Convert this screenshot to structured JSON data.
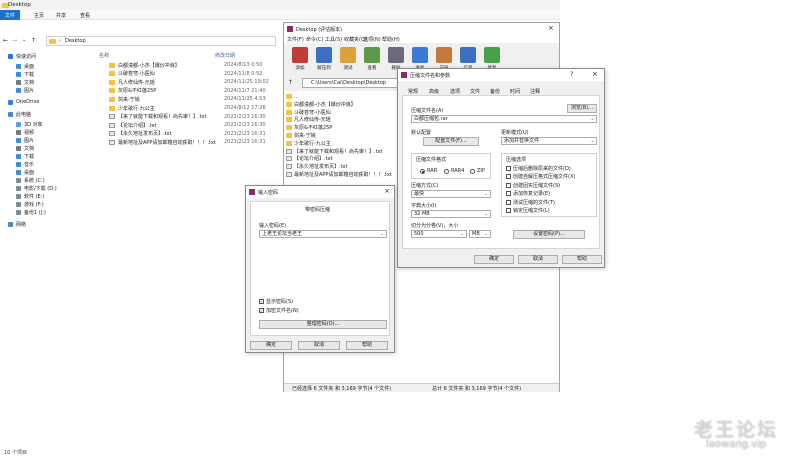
{
  "explorer": {
    "title": "Desktop",
    "ribbon_tabs": [
      "文件",
      "主页",
      "共享",
      "查看"
    ],
    "address": "Desktop",
    "columns": {
      "name": "名称",
      "date": "修改日期"
    },
    "nav": [
      {
        "label": "快速访问",
        "color": "#2b73d8"
      },
      {
        "label": "桌面",
        "color": "#3a8ee6"
      },
      {
        "label": "下载",
        "color": "#3a8ee6"
      },
      {
        "label": "文档",
        "color": "#6b7b8c"
      },
      {
        "label": "图片",
        "color": "#3a8ee6"
      },
      {
        "label": "OneDrive",
        "color": "#2f7fdf"
      },
      {
        "label": "此电脑",
        "color": "#4a88c7"
      },
      {
        "label": "3D 对象",
        "color": "#55a0e0"
      },
      {
        "label": "视频",
        "color": "#6b7b8c"
      },
      {
        "label": "图片",
        "color": "#3a8ee6"
      },
      {
        "label": "文档",
        "color": "#6b7b8c"
      },
      {
        "label": "下载",
        "color": "#3a8ee6"
      },
      {
        "label": "音乐",
        "color": "#3a8ee6"
      },
      {
        "label": "桌面",
        "color": "#3a8ee6"
      },
      {
        "label": "系统 (C:)",
        "color": "#7a8a9a"
      },
      {
        "label": "电影/下载 (D:)",
        "color": "#7a8a9a"
      },
      {
        "label": "软件 (E:)",
        "color": "#7a8a9a"
      },
      {
        "label": "游戏 (F:)",
        "color": "#7a8a9a"
      },
      {
        "label": "备份1 (J:)",
        "color": "#7a8a9a"
      },
      {
        "label": "网络",
        "color": "#4a88c7"
      }
    ],
    "files": [
      {
        "name": "白都濛都-小杰【爆炒冲浪】",
        "date": "2024/8/13 0:50",
        "type": "folder"
      },
      {
        "name": "斗破苍穹-小医仙",
        "date": "2024/11/8 0:52",
        "type": "folder"
      },
      {
        "name": "凡人修仙传-元瑶",
        "date": "2024/11/25 19:02",
        "type": "folder"
      },
      {
        "name": "灰原&不红莲25P",
        "date": "2024/11/7 21:40",
        "type": "folder"
      },
      {
        "name": "剑来-宁姚",
        "date": "2024/11/25 4:53",
        "type": "folder"
      },
      {
        "name": "少年歌行-九公主",
        "date": "2024/8/12 17:26",
        "type": "folder"
      },
      {
        "name": "【来了就能下载和观看！尚先审！】.txt",
        "date": "2023/2/23 16:30",
        "type": "txt"
      },
      {
        "name": "【论坛介绍】.txt",
        "date": "2023/2/23 16:30",
        "type": "txt"
      },
      {
        "name": "【永久地址发布页】.txt",
        "date": "2023/2/23 16:31",
        "type": "txt"
      },
      {
        "name": "最新地址及APP请加邮箱自动获取！！！.txt",
        "date": "2023/2/23 16:31",
        "type": "txt"
      }
    ],
    "status": "10 个项目"
  },
  "winrar": {
    "title": "Desktop (评估版本)",
    "menu": [
      "文件(F)",
      "命令(C)",
      "工具(S)",
      "收藏夹(O)",
      "选项(N)",
      "帮助(H)"
    ],
    "toolbar": [
      {
        "label": "添加",
        "color": "#c23a3a"
      },
      {
        "label": "解压到",
        "color": "#3a6fc2"
      },
      {
        "label": "测试",
        "color": "#d9a23a"
      },
      {
        "label": "查看",
        "color": "#5a9a4a"
      },
      {
        "label": "删除",
        "color": "#6a6a7a"
      },
      {
        "label": "查找",
        "color": "#3a7ad9"
      },
      {
        "label": "向导",
        "color": "#c27a3a"
      },
      {
        "label": "信息",
        "color": "#3a6fc2"
      },
      {
        "label": "修复",
        "color": "#4aa04a"
      }
    ],
    "path": "C:\\Users\\Cai\\Desktop\\Desktop",
    "files": [
      "..",
      "白都濛都-小杰【爆炒冲浪】",
      "斗破苍穹-小医仙",
      "凡人修仙传-元瑶",
      "灰原&不红莲25P",
      "剑来-宁姚",
      "少年歌行-九公主",
      "【来了就能下载和观看！尚先审！】.txt",
      "【论坛介绍】.txt",
      "【永久地址发布页】.txt",
      "最新地址及APP请加邮箱自动获取！！！.txt"
    ],
    "status_left": "已经选择 6 文件夹 和 3,169 字节(4 个文件)",
    "status_right": "总计 6 文件夹 和 3,169 字节(4 个文件)"
  },
  "archive_dialog": {
    "title": "压缩文件名和参数",
    "tabs": [
      "常规",
      "高级",
      "选项",
      "文件",
      "备份",
      "时间",
      "注释"
    ],
    "archive_name_label": "压缩文件名(A)",
    "archive_name": "白都压缩包.rar",
    "browse": "浏览(B)...",
    "profile_label": "默认配置",
    "profile_button": "配置文件(F)...",
    "update_label": "更新模式(U)",
    "update_value": "添加并替换文件",
    "format_label": "压缩文件格式",
    "formats": [
      "RAR",
      "RAR4",
      "ZIP"
    ],
    "method_label": "压缩方式(C)",
    "method_value": "最快",
    "dict_label": "字典大小(I)",
    "dict_value": "32 MB",
    "split_label": "切分为分卷(V)，大小",
    "split_value": "500",
    "split_unit": "MB",
    "options_label": "压缩选项",
    "options": [
      {
        "label": "压缩后删除原来的文件(D)",
        "checked": false
      },
      {
        "label": "创建自解压格式压缩文件(X)",
        "checked": false
      },
      {
        "label": "创建固实压缩文件(S)",
        "checked": false
      },
      {
        "label": "添加恢复记录(E)",
        "checked": false
      },
      {
        "label": "测试压缩的文件(T)",
        "checked": false
      },
      {
        "label": "锁定压缩文件(L)",
        "checked": false
      }
    ],
    "set_password": "设置密码(P)...",
    "ok": "确定",
    "cancel": "取消",
    "help": "帮助"
  },
  "password_dialog": {
    "title": "输入密码",
    "heading": "带密码压缩",
    "field_label": "输入密码(E)",
    "field_value": "上老王论坛当老王",
    "show_password": "显示密码(S)",
    "encrypt_names": "加密文件名(N)",
    "organize": "整理密码(O)...",
    "ok": "确定",
    "cancel": "取消",
    "help": "帮助"
  },
  "watermark": {
    "main": "老王论坛",
    "url": "laowang.vip"
  }
}
